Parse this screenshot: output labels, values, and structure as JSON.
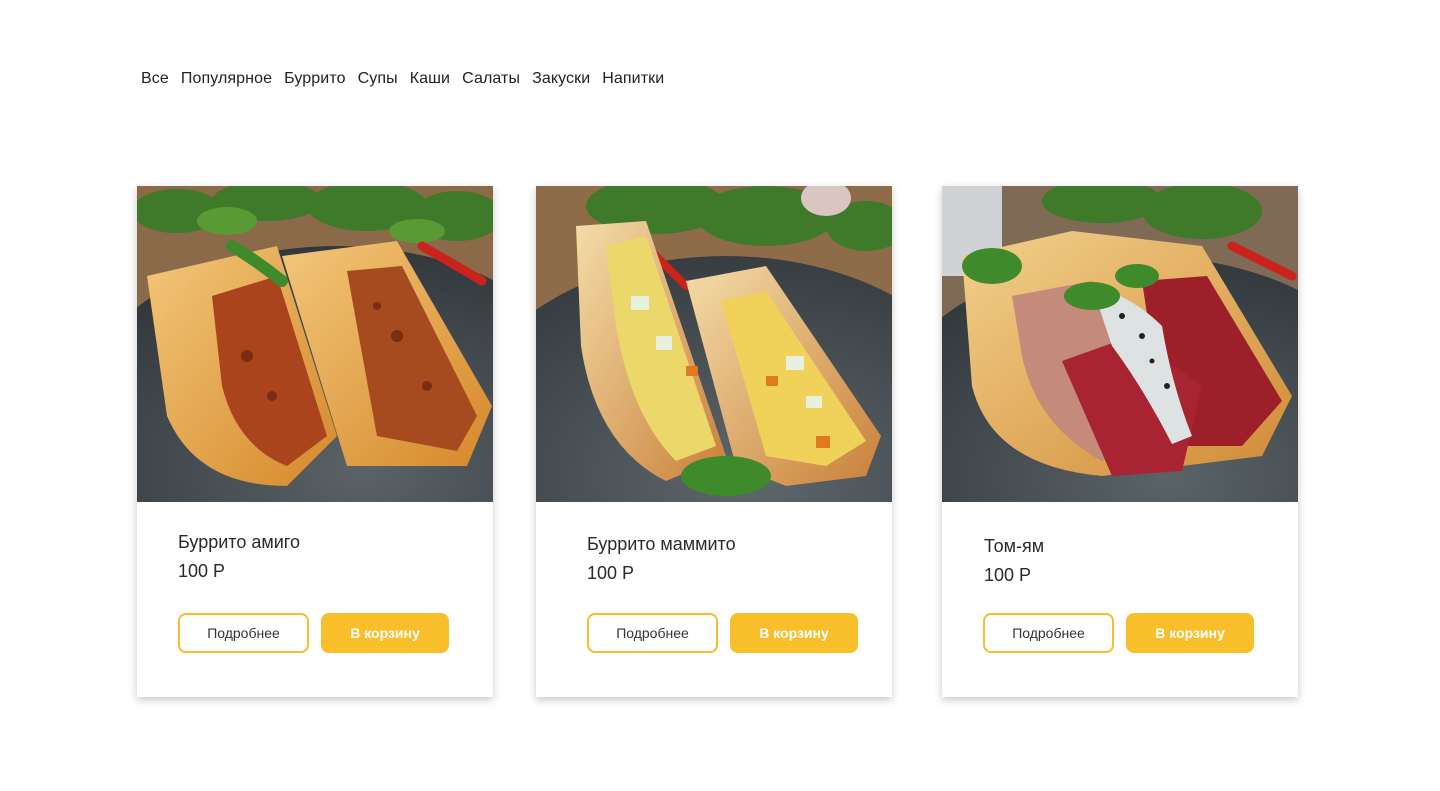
{
  "nav": {
    "items": [
      "Все",
      "Популярное",
      "Буррито",
      "Супы",
      "Каши",
      "Салаты",
      "Закуски",
      "Напитки"
    ]
  },
  "colors": {
    "accent": "#f8bf2a",
    "text": "#222222"
  },
  "products": [
    {
      "title": "Буррито амиго",
      "price": "100 Р",
      "more_label": "Подробнее",
      "cart_label": "В корзину",
      "filling": "beef"
    },
    {
      "title": "Буррито маммито",
      "price": "100 Р",
      "more_label": "Подробнее",
      "cart_label": "В корзину",
      "filling": "chicken"
    },
    {
      "title": "Том-ям",
      "price": "100 Р",
      "more_label": "Подробнее",
      "cart_label": "В корзину",
      "filling": "beet"
    }
  ]
}
